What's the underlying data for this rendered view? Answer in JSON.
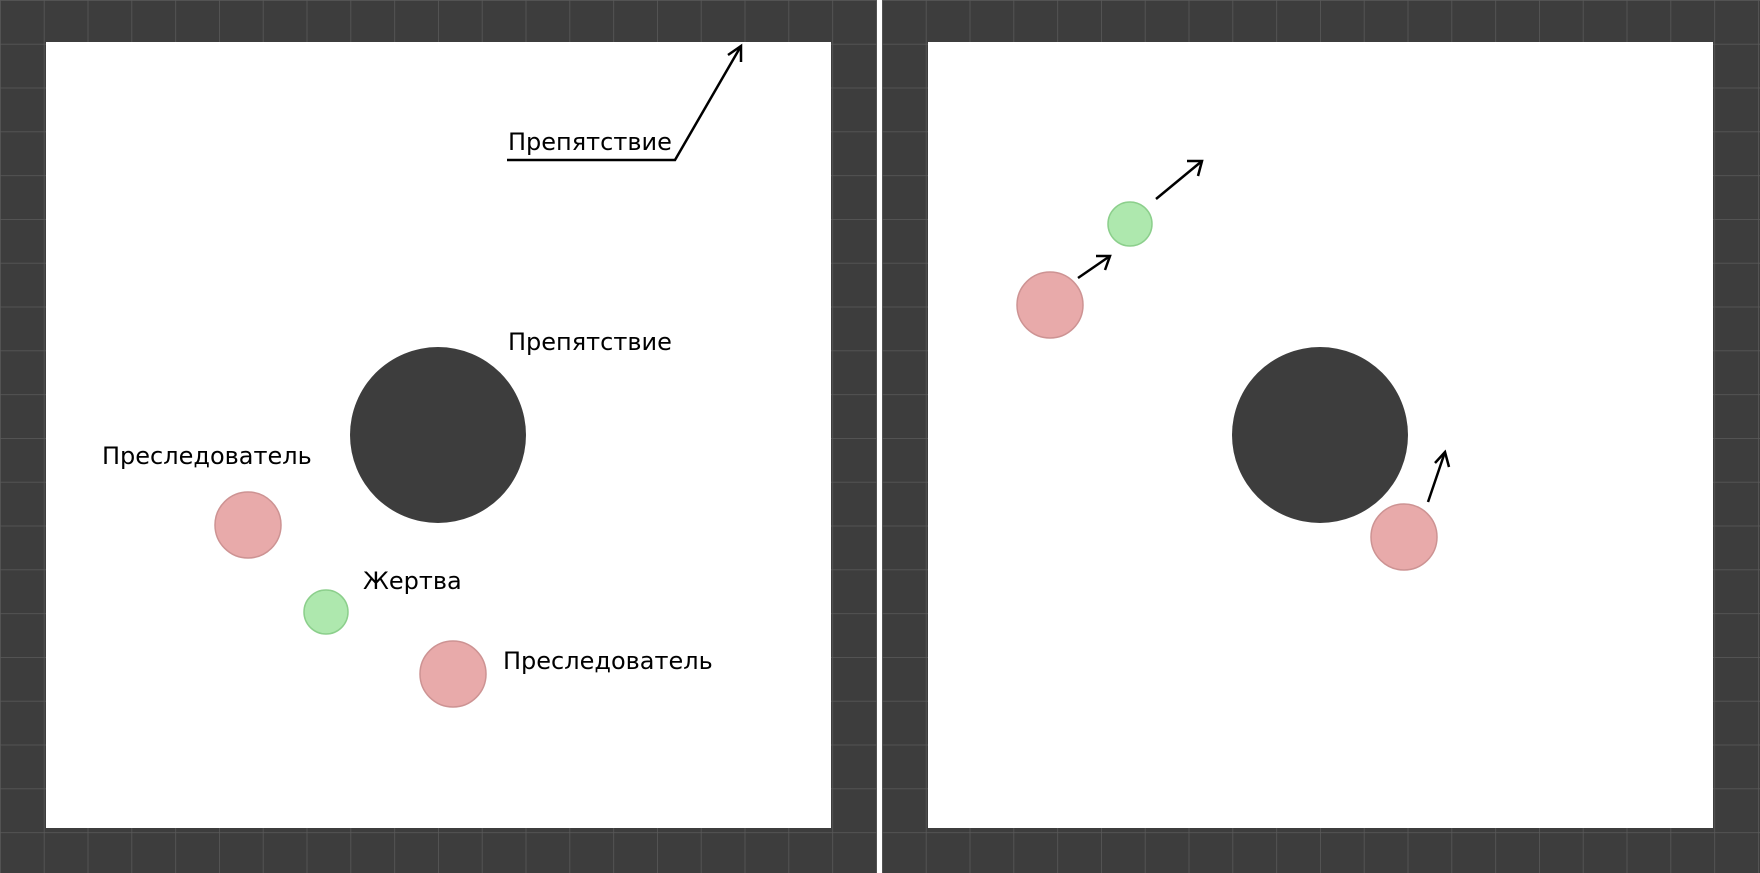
{
  "colors": {
    "wall": "#3d3d3d",
    "wall_grid": "#5a5a5a",
    "arena": "#ffffff",
    "obstacle": "#3d3d3d",
    "pursuer_fill": "#e8aaaa",
    "pursuer_stroke": "#cd9393",
    "prey_fill": "#aee8ae",
    "prey_stroke": "#8ccf8c",
    "arrow": "#000000",
    "label": "#000000"
  },
  "icons": {
    "pursuer": "pink-circle",
    "prey": "green-circle",
    "obstacle": "dark-circle",
    "direction": "arrow-icon"
  },
  "left_panel": {
    "labels": {
      "wall_obstacle": "Препятствие",
      "center_obstacle": "Препятствие",
      "pursuer_top": "Преследователь",
      "prey": "Жертва",
      "pursuer_bottom": "Преследователь"
    }
  },
  "right_panel": {}
}
